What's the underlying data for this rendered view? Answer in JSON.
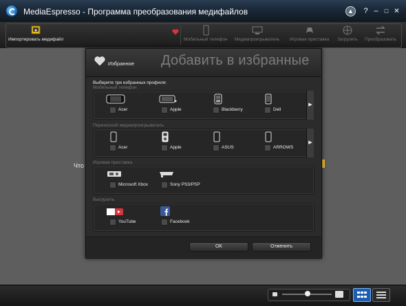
{
  "window": {
    "title": "MediaEspresso - Программа преобразования медифайлов",
    "controls": {
      "upgrade_icon": "upgrade-icon",
      "help": "?",
      "minimize": "–",
      "maximize": "□",
      "close": "✕"
    }
  },
  "toolbar": {
    "import_label": "Импортировать медифайл",
    "items": [
      {
        "label": "Мобильный телефон",
        "icon": "phone-icon"
      },
      {
        "label": "Медиапроигрыватель",
        "icon": "media-player-icon"
      },
      {
        "label": "Игровая приставка",
        "icon": "game-console-icon"
      },
      {
        "label": "Загрузить",
        "icon": "globe-upload-icon"
      },
      {
        "label": "Преобразовать",
        "icon": "convert-icon"
      }
    ]
  },
  "background": {
    "hint_text": "Что"
  },
  "dialog": {
    "favorites_label": "Избранное",
    "title": "Добавить в избранные",
    "instruction": "Выберите три избранных профиля:",
    "categories": [
      {
        "title": "Мобильный телефон",
        "devices": [
          "Acer",
          "Apple",
          "Blackberry",
          "Dell"
        ],
        "has_more": true
      },
      {
        "title": "Переносной медиапроигрыватель",
        "devices": [
          "Acer",
          "Apple",
          "ASUS",
          "ARROWS"
        ],
        "has_more": true
      },
      {
        "title": "Игровая приставка",
        "devices": [
          "Microsoft Xbox",
          "Sony PS3/PSP"
        ],
        "has_more": false
      },
      {
        "title": "Выгрузить",
        "devices": [
          "YouTube",
          "Facebook"
        ],
        "has_more": false
      }
    ],
    "more_arrow": "▶",
    "ok_label": "OK",
    "cancel_label": "Отменить"
  },
  "colors": {
    "accent_blue": "#1d5fb0",
    "heart_red": "#d9333f",
    "dialog_bg": "#2b2b2b",
    "main_bg": "#5e5e5e"
  }
}
